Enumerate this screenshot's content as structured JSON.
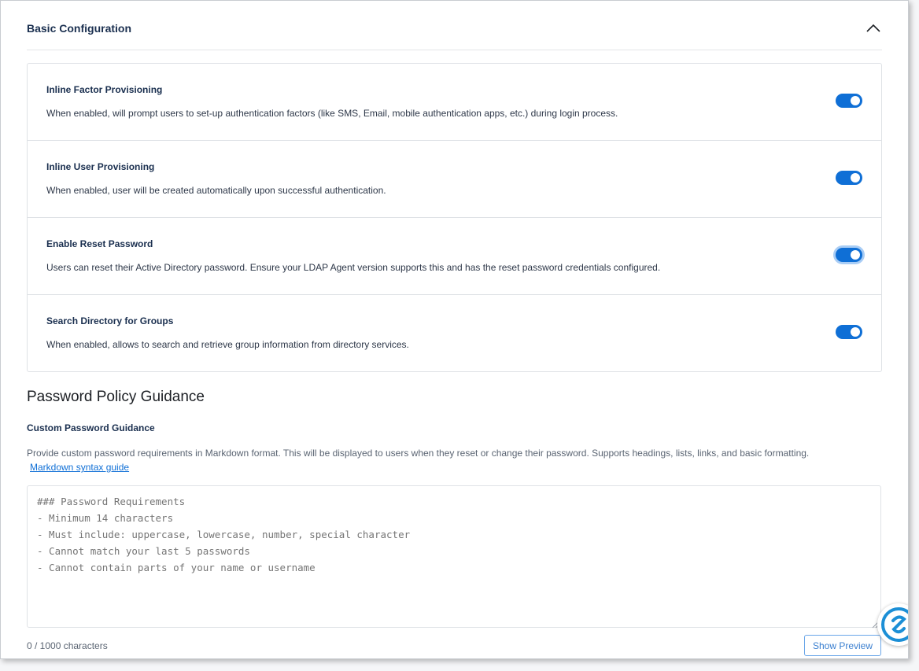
{
  "basic_config": {
    "title": "Basic Configuration",
    "collapse_icon": "chevron-up-icon",
    "settings": [
      {
        "title": "Inline Factor Provisioning",
        "description": "When enabled, will prompt users to set-up authentication factors (like SMS, Email, mobile authentication apps, etc.) during login process.",
        "enabled": true
      },
      {
        "title": "Inline User Provisioning",
        "description": "When enabled, user will be created automatically upon successful authentication.",
        "enabled": true
      },
      {
        "title": "Enable Reset Password",
        "description": "Users can reset their Active Directory password. Ensure your LDAP Agent version supports this and has the reset password credentials configured.",
        "enabled": true
      },
      {
        "title": "Search Directory for Groups",
        "description": "When enabled, allows to search and retrieve group information from directory services.",
        "enabled": true
      }
    ]
  },
  "password_policy": {
    "heading": "Password Policy Guidance",
    "field_label": "Custom Password Guidance",
    "help_text": "Provide custom password requirements in Markdown format. This will be displayed to users when they reset or change their password. Supports headings, lists, links, and basic formatting.",
    "help_link": "Markdown syntax guide",
    "placeholder": "### Password Requirements\n- Minimum 14 characters\n- Must include: uppercase, lowercase, number, special character\n- Cannot match your last 5 passwords\n- Cannot contain parts of your name or username",
    "char_count": "0 / 1000 characters",
    "preview_button": "Show Preview"
  },
  "colors": {
    "toggle_on": "#0f6fd6",
    "heading": "#1a2f4f",
    "link": "#0f6fd6",
    "fab_brand": "#1c8fd6"
  }
}
